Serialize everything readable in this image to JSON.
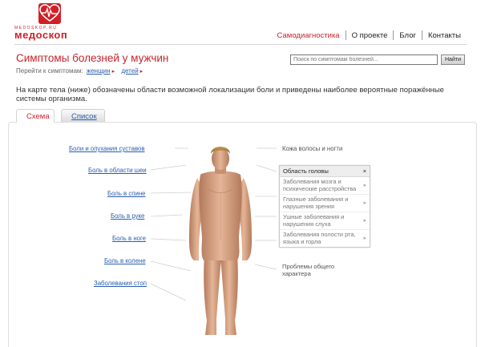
{
  "logo": {
    "small_text": "MEDOSKOP.RU",
    "brand": "медоскоп",
    "color": "#d21f26"
  },
  "nav": {
    "items": [
      "Самодиагностика",
      "О проекте",
      "Блог",
      "Контакты"
    ],
    "active_index": 0
  },
  "header": {
    "title": "Симптомы болезней у мужчин"
  },
  "search": {
    "placeholder": "Поиск по симптомам болезней...",
    "button_label": "Найти"
  },
  "goto": {
    "label": "Перейти к симптомам:",
    "links": [
      "женщин",
      "детей"
    ]
  },
  "description": "На карте тела (ниже) обозначены области возможной локализации боли и приведены наиболее вероятные поражённые системы организма.",
  "tabs": [
    "Схема",
    "Список"
  ],
  "left_links": [
    "Боли и опухания суставов",
    "Боль в области шеи",
    "Боль в спине",
    "Боль в руке",
    "Боль в ноге",
    "Боль в колене",
    "Заболевания стоп"
  ],
  "right_labels": {
    "hair": "Кожа волосы и ногти",
    "general": "Проблемы общего характера"
  },
  "popup": {
    "title": "Область головы",
    "close": "×",
    "items": [
      "Заболевания мозга и психические расстройства",
      "Глазные заболевания и нарушения зрения",
      "Ушные заболевания и нарушения слуха",
      "Заболевания полости рта, языка и горла"
    ]
  },
  "colors": {
    "accent": "#c8232c",
    "link": "#2a5db0",
    "skin": "#d9a686"
  }
}
